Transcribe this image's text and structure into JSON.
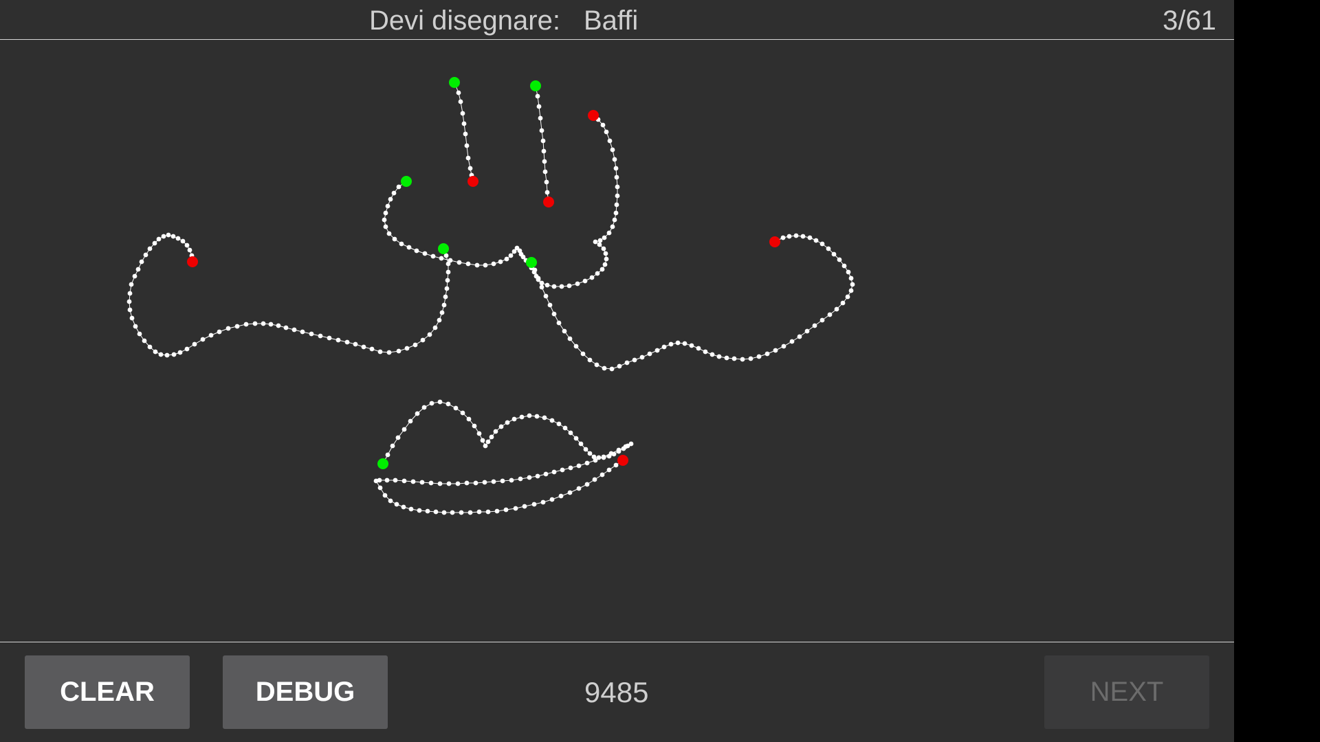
{
  "header": {
    "prompt_label": "Devi disegnare:",
    "target_word": "Baffi",
    "progress": "3/61"
  },
  "canvas": {
    "background": "#2f2f2f",
    "stroke_color": "#ffffff",
    "start_marker_color": "#00ee00",
    "end_marker_color": "#ee0000"
  },
  "footer": {
    "clear_label": "CLEAR",
    "debug_label": "DEBUG",
    "score": "9485",
    "next_label": "NEXT",
    "next_enabled": false
  }
}
